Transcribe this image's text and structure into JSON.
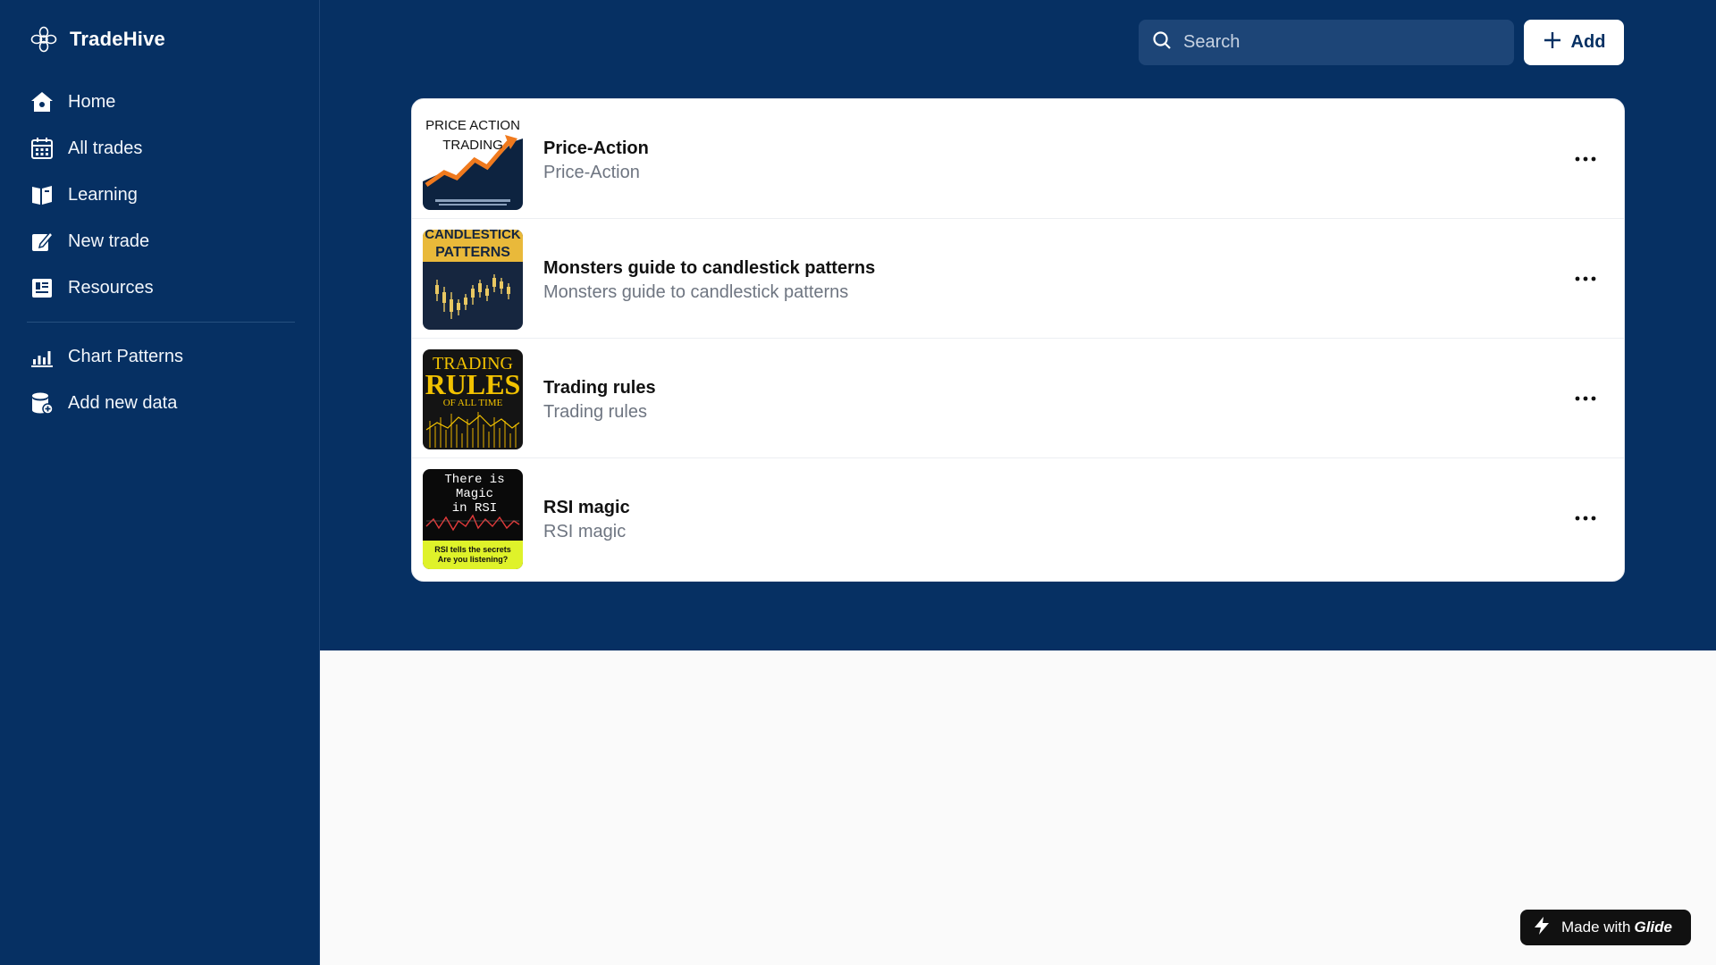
{
  "app": {
    "name": "TradeHive"
  },
  "sidebar": {
    "items": [
      {
        "label": "Home",
        "icon": "home-icon"
      },
      {
        "label": "All trades",
        "icon": "calendar-icon"
      },
      {
        "label": "Learning",
        "icon": "book-icon"
      },
      {
        "label": "New trade",
        "icon": "edit-icon"
      },
      {
        "label": "Resources",
        "icon": "newspaper-icon"
      }
    ],
    "secondary": [
      {
        "label": "Chart Patterns",
        "icon": "bar-chart-icon"
      },
      {
        "label": "Add new data",
        "icon": "database-add-icon"
      }
    ]
  },
  "header": {
    "search_placeholder": "Search",
    "add_label": "Add"
  },
  "list": {
    "items": [
      {
        "title": "Price-Action",
        "subtitle": "Price-Action",
        "thumb": {
          "line1": "PRICE ACTION",
          "line2": "TRADING"
        }
      },
      {
        "title": "Monsters guide to candlestick patterns",
        "subtitle": "Monsters guide to candlestick patterns",
        "thumb": {
          "line1": "CANDLESTICK",
          "line2": "PATTERNS"
        }
      },
      {
        "title": "Trading rules",
        "subtitle": "Trading rules",
        "thumb": {
          "line1": "TRADING",
          "line2": "RULES",
          "line3": "OF ALL TIME"
        }
      },
      {
        "title": "RSI magic",
        "subtitle": "RSI magic",
        "thumb": {
          "line1": "There is",
          "line2": "Magic",
          "line3": "in RSI",
          "line4": "RSI tells the secrets",
          "line5": "Are you listening?"
        }
      }
    ]
  },
  "footer": {
    "badge_prefix": "Made with",
    "badge_brand": "Glide"
  },
  "colors": {
    "primary": "#063063",
    "search_bg": "#1d4577",
    "page_bg": "#fafafa"
  }
}
